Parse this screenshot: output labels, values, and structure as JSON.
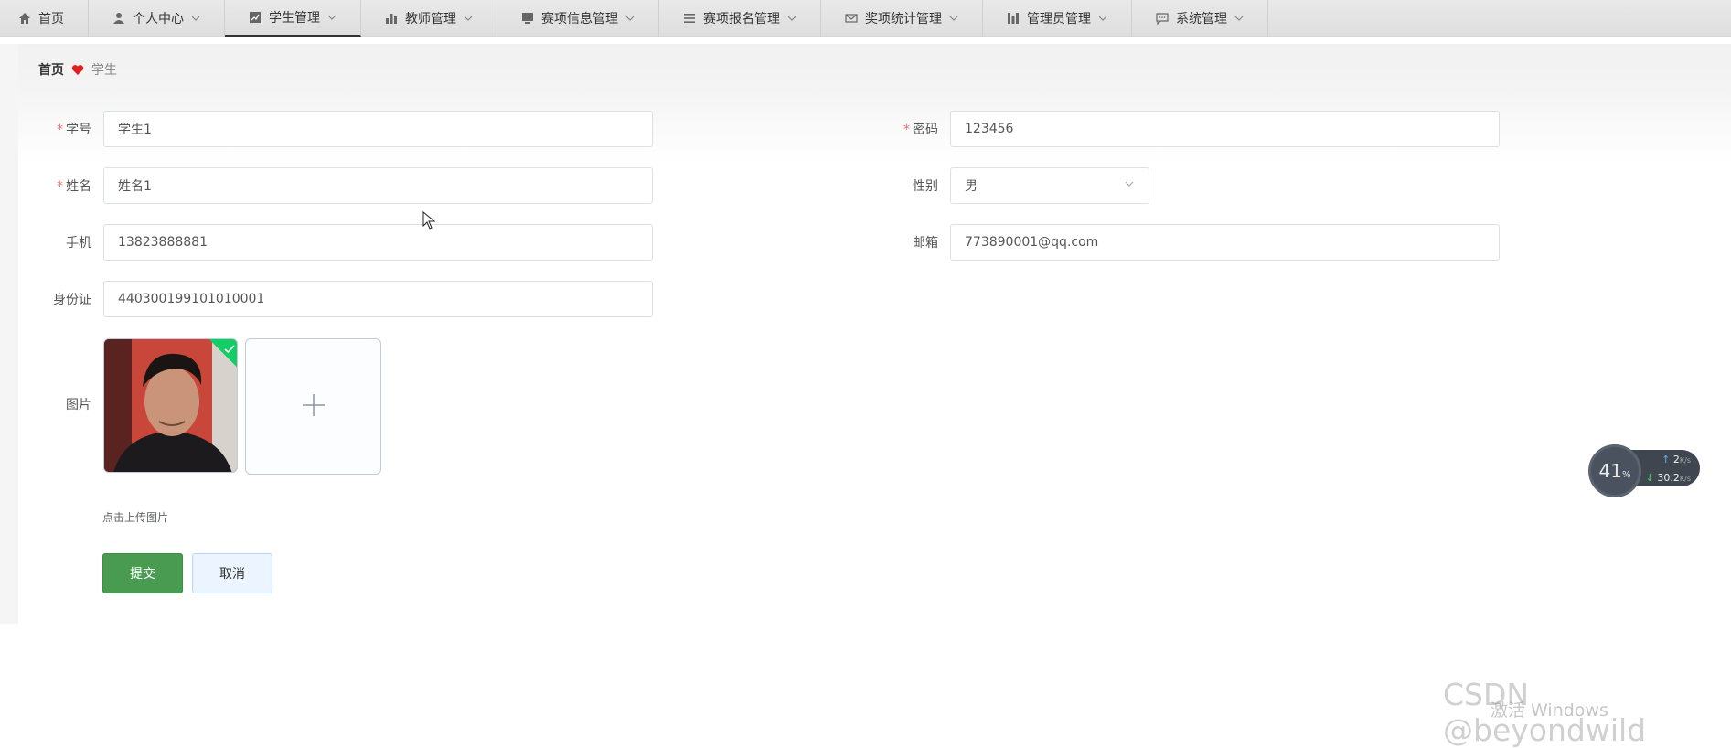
{
  "nav": {
    "items": [
      {
        "label": "首页",
        "icon": "home-icon"
      },
      {
        "label": "个人中心",
        "icon": "user-icon"
      },
      {
        "label": "学生管理",
        "icon": "chart-icon",
        "active": true
      },
      {
        "label": "教师管理",
        "icon": "bar-chart-icon"
      },
      {
        "label": "赛项信息管理",
        "icon": "monitor-icon"
      },
      {
        "label": "赛项报名管理",
        "icon": "list-icon"
      },
      {
        "label": "奖项统计管理",
        "icon": "mail-icon"
      },
      {
        "label": "管理员管理",
        "icon": "columns-icon"
      },
      {
        "label": "系统管理",
        "icon": "chat-icon"
      }
    ]
  },
  "breadcrumb": {
    "home": "首页",
    "current": "学生"
  },
  "form": {
    "student_id": {
      "label": "学号",
      "value": "学生1"
    },
    "password": {
      "label": "密码",
      "value": "123456"
    },
    "name": {
      "label": "姓名",
      "value": "姓名1"
    },
    "gender": {
      "label": "性别",
      "value": "男"
    },
    "phone": {
      "label": "手机",
      "value": "13823888881"
    },
    "email": {
      "label": "邮箱",
      "value": "773890001@qq.com"
    },
    "id_card": {
      "label": "身份证",
      "value": "440300199101010001"
    },
    "image": {
      "label": "图片",
      "tip": "点击上传图片"
    },
    "required_mark": "*"
  },
  "buttons": {
    "submit": "提交",
    "cancel": "取消"
  },
  "net_widget": {
    "percent": "41",
    "percent_unit": "%",
    "up": "2",
    "up_unit": "K/s",
    "down": "30.2",
    "down_unit": "K/s"
  },
  "watermark": {
    "csdn": "CSDN @beyondwild",
    "windows": "激活 Windows"
  },
  "colors": {
    "submit": "#4a9b52",
    "required": "#f56c6c",
    "success_badge": "#13ce66"
  }
}
